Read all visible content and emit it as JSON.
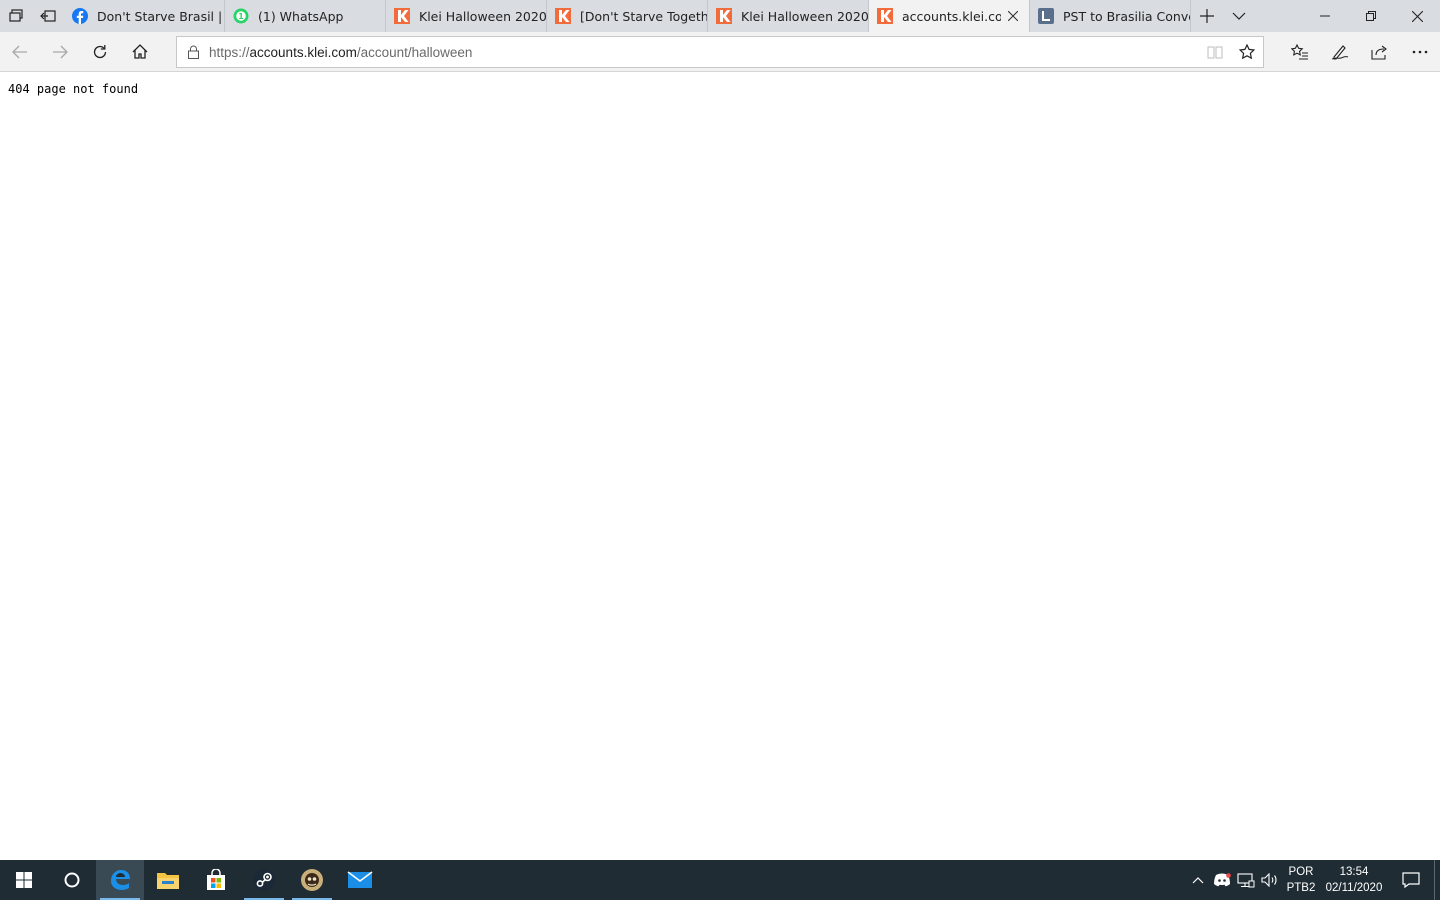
{
  "browser": {
    "tabs": [
      {
        "title": "Don't Starve Brasil | F",
        "icon": "facebook-icon",
        "color": "#1877f2",
        "active": false
      },
      {
        "title": "(1) WhatsApp",
        "icon": "whatsapp-icon",
        "color": "#25d366",
        "active": false
      },
      {
        "title": "Klei Halloween 2020",
        "icon": "klei-icon",
        "color": "#f26b3a",
        "active": false
      },
      {
        "title": "[Don't Starve Togeth",
        "icon": "klei-icon",
        "color": "#f26b3a",
        "active": false
      },
      {
        "title": "Klei Halloween 2020",
        "icon": "klei-icon",
        "color": "#f26b3a",
        "active": false
      },
      {
        "title": "accounts.klei.com",
        "icon": "klei-icon",
        "color": "#f26b3a",
        "active": true
      },
      {
        "title": "PST to Brasilia Conve",
        "icon": "timezone-icon",
        "color": "#5a6f8c",
        "active": false
      }
    ],
    "address": {
      "scheme": "https://",
      "host": "accounts.klei.com",
      "path": "/account/halloween"
    }
  },
  "page": {
    "body_text": "404 page not found"
  },
  "taskbar": {
    "language": "POR",
    "layout": "PTB2",
    "time": "13:54",
    "date": "02/11/2020"
  }
}
